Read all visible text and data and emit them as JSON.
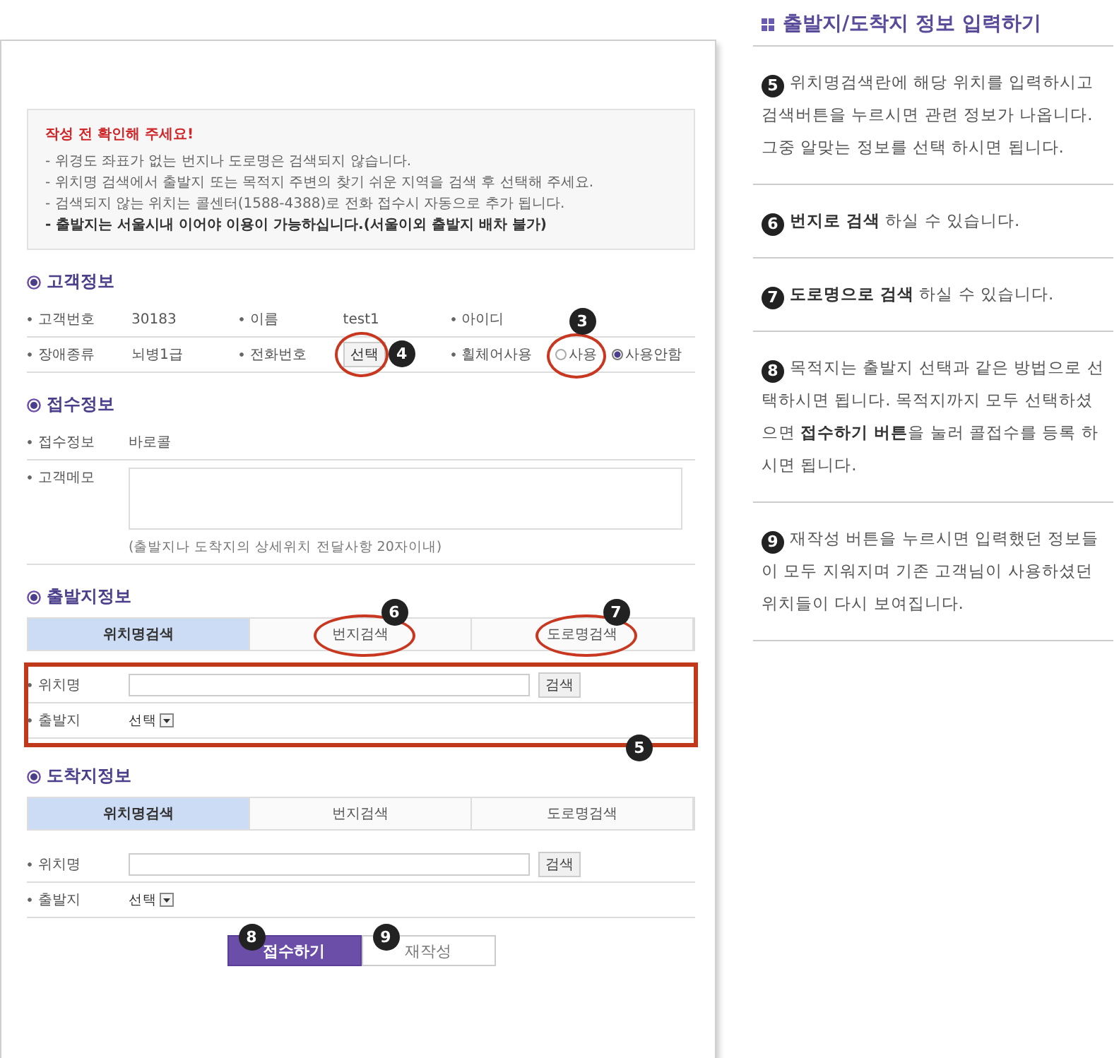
{
  "notice": {
    "title": "작성 전 확인해 주세요!",
    "lines": [
      {
        "text": "- 위경도 좌표가 없는 번지나 도로명은 검색되지 않습니다.",
        "bold": false
      },
      {
        "text": "- 위치명 검색에서 출발지 또는 목적지 주변의 찾기 쉬운 지역을 검색 후 선택해 주세요.",
        "bold": false
      },
      {
        "text": "- 검색되지 않는 위치는 콜센터(1588-4388)로 전화 접수시 자동으로 추가 됩니다.",
        "bold": false
      },
      {
        "text": "- 출발지는 서울시내 이어야 이용이 가능하십니다.(서울이외 출발지 배차 불가)",
        "bold": true
      }
    ]
  },
  "customer": {
    "heading": "고객정보",
    "rows": [
      [
        {
          "label": "고객번호",
          "kind": "text",
          "value": "30183"
        },
        {
          "label": "이름",
          "kind": "text",
          "value": "test1"
        },
        {
          "label": "아이디",
          "kind": "text"
        }
      ],
      [
        {
          "label": "장애종류",
          "kind": "text",
          "value": "뇌병1급"
        },
        {
          "label": "전화번호",
          "kind": "select-button",
          "value": "선택",
          "callout": "4"
        },
        {
          "label": "휠체어사용",
          "kind": "radio",
          "options": [
            {
              "label": "사용",
              "selected": false,
              "callout": "3"
            },
            {
              "label": "사용안함",
              "selected": true
            }
          ]
        }
      ]
    ]
  },
  "reception": {
    "heading": "접수정보",
    "rows": [
      {
        "label": "접수정보",
        "kind": "text",
        "value": "바로콜"
      },
      {
        "label": "고객메모",
        "kind": "memo",
        "hint": "(출발지나 도착지의 상세위치 전달사항 20자이내)"
      }
    ]
  },
  "places": [
    {
      "heading": "출발지정보",
      "callout": "5",
      "tabs": [
        {
          "label": "위치명검색",
          "selected": true
        },
        {
          "label": "번지검색",
          "selected": false,
          "callout": "6"
        },
        {
          "label": "도로명검색",
          "selected": false,
          "callout": "7"
        }
      ],
      "fields": [
        {
          "label": "위치명",
          "kind": "search",
          "button": "검색"
        },
        {
          "label": "출발지",
          "kind": "select",
          "value": "선택"
        }
      ]
    },
    {
      "heading": "도착지정보",
      "tabs": [
        {
          "label": "위치명검색",
          "selected": true
        },
        {
          "label": "번지검색",
          "selected": false
        },
        {
          "label": "도로명검색",
          "selected": false
        }
      ],
      "fields": [
        {
          "label": "위치명",
          "kind": "search",
          "button": "검색"
        },
        {
          "label": "출발지",
          "kind": "select",
          "value": "선택"
        }
      ]
    }
  ],
  "buttons": [
    {
      "label": "접수하기",
      "kind": "primary",
      "callout": "8"
    },
    {
      "label": "재작성",
      "kind": "secondary",
      "callout": "9"
    }
  ],
  "guide": {
    "title": "출발지/도착지 정보 입력하기",
    "steps": [
      {
        "number": "5",
        "text": "위치명검색란에 해당 위치를 입력하시고 검색버튼을 누르시면 관련 정보가 나옵니다. 그중 알맞는 정보를 선택 하시면 됩니다."
      },
      {
        "number": "6",
        "text": "**번지로 검색** 하실 수 있습니다."
      },
      {
        "number": "7",
        "text": "**도로명으로 검색** 하실 수 있습니다."
      },
      {
        "number": "8",
        "text": "목적지는 출발지 선택과 같은 방법으로 선택하시면 됩니다. 목적지까지 모두 선택하셨으면 **접수하기 버튼**을 눌러 콜접수를 등록 하시면 됩니다."
      },
      {
        "number": "9",
        "text": "재작성 버튼을 누르시면 입력했던 정보들이 모두 지워지며 기존 고객님이 사용하셨던 위치들이 다시 보여집니다."
      }
    ]
  }
}
